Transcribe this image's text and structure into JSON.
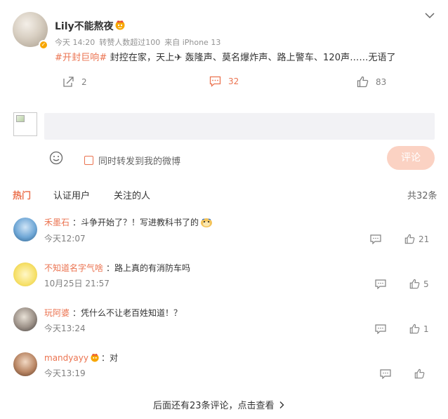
{
  "post": {
    "username": "Lily不能熬夜",
    "member_icon": "vip-member-icon",
    "verified_icon": "verified-badge-icon",
    "time": "今天 14:20",
    "repost_note": "转赞人数超过100",
    "source": "来自 iPhone 13",
    "topic": "#开封巨响#",
    "text": " 封控在家，天上✈ 轰隆声、莫名爆炸声、路上警车、120声……无语了",
    "forward_count": "2",
    "comment_count": "32",
    "like_count": "83"
  },
  "composer": {
    "input_placeholder": "",
    "forward_label": "同时转发到我的微博",
    "submit_label": "评论"
  },
  "tabs": [
    {
      "label": "热门",
      "active": true
    },
    {
      "label": "认证用户",
      "active": false
    },
    {
      "label": "关注的人",
      "active": false
    }
  ],
  "total_comments": "共32条",
  "comments": [
    {
      "name": "禾墨石",
      "text": "：斗争开始了？！写进教科书了的",
      "emoji": "doge-emoji",
      "time": "今天12:07",
      "likes": "21"
    },
    {
      "name": "不知道名字气啥",
      "text": "：路上真的有消防车吗",
      "time": "10月25日 21:57",
      "likes": "5"
    },
    {
      "name": "玩阿婆",
      "text": "：凭什么不让老百姓知道！？",
      "time": "今天13:24",
      "likes": "1"
    },
    {
      "name": "mandyayy",
      "text": "：对",
      "time": "今天13:19",
      "likes": ""
    }
  ],
  "more_comments": "后面还有23条评论，点击查看",
  "colors": {
    "accent": "#eb7350",
    "submit_disabled": "#fbd2c3",
    "input_bg": "#f2f2f5",
    "meta": "#939393"
  }
}
